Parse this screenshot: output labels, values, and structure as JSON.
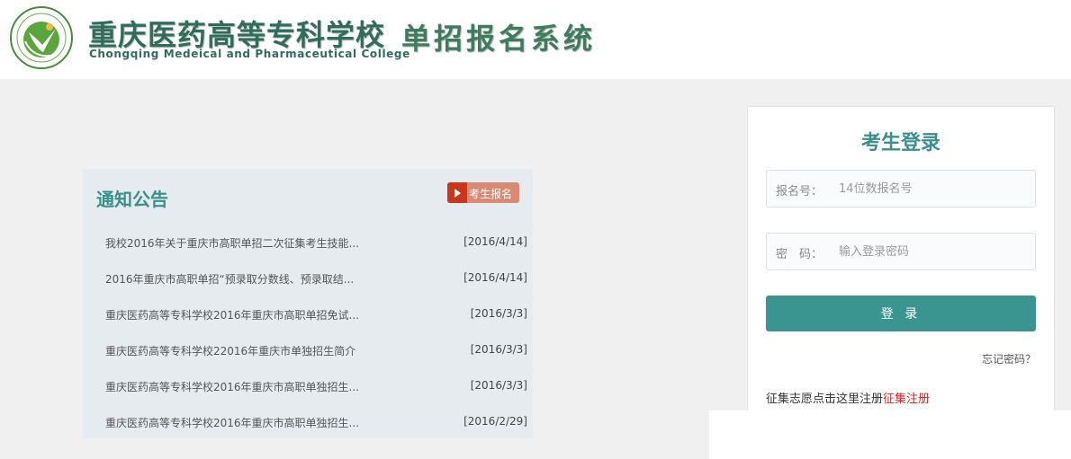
{
  "header": {
    "school_name": "重庆医药高等专科学校",
    "school_name_en": "Chongqing Medeical and Pharmaceutical College",
    "system_name": "单招报名系统"
  },
  "notice": {
    "title": "通知公告",
    "register_button": "考生报名",
    "items": [
      {
        "title": "我校2016年关于重庆市高职单招二次征集考生技能...",
        "date": "[2016/4/14]"
      },
      {
        "title": "2016年重庆市高职单招“预录取分数线、预录取结...",
        "date": "[2016/4/14]"
      },
      {
        "title": "重庆医药高等专科学校2016年重庆市高职单招免试...",
        "date": "[2016/3/3]"
      },
      {
        "title": "重庆医药高等专科学校22016年重庆市单独招生简介",
        "date": "[2016/3/3]"
      },
      {
        "title": "重庆医药高等专科学校2016年重庆市高职单独招生...",
        "date": "[2016/3/3]"
      },
      {
        "title": "重庆医药高等专科学校2016年重庆市高职单独招生...",
        "date": "[2016/2/29]"
      }
    ]
  },
  "login": {
    "title": "考生登录",
    "reg_label": "报名号：",
    "reg_placeholder": "14位数报名号",
    "pwd_label": "密　码：",
    "pwd_placeholder": "输入登录密码",
    "submit_label": "登 录",
    "forgot_label": "忘记密码？",
    "collect_text": "征集志愿点击这里注册",
    "collect_link": "征集注册"
  },
  "colors": {
    "accent": "#3a9591",
    "title_green": "#2f6d5a",
    "link_red": "#e02020",
    "notice_bg": "#e6ebef",
    "register_btn": "#d98a73",
    "page_bg": "#f0f0f0"
  },
  "icons": [
    "school-logo-icon",
    "play-icon"
  ]
}
